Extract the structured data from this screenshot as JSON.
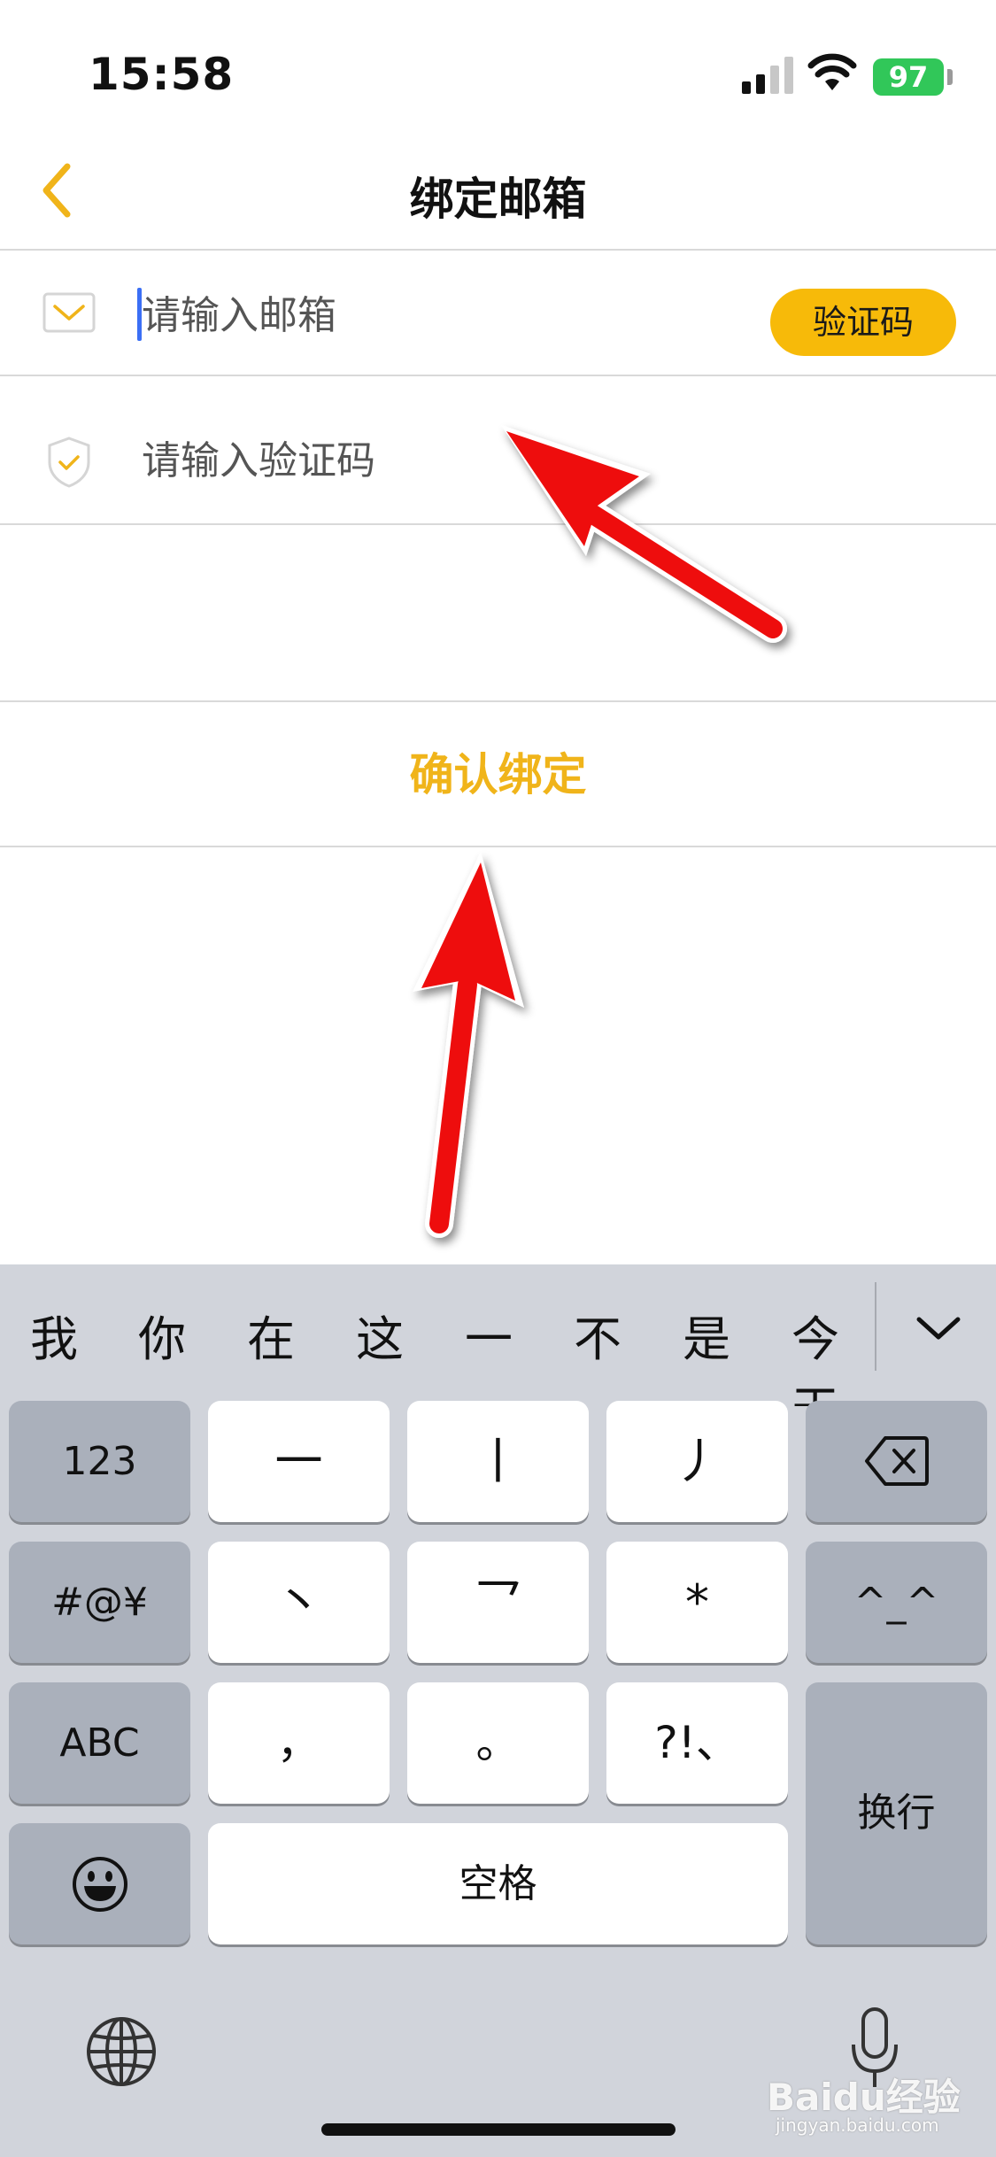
{
  "status_bar": {
    "time": "15:58",
    "battery": "97"
  },
  "nav": {
    "title": "绑定邮箱"
  },
  "form": {
    "email_placeholder": "请输入邮箱",
    "code_button": "验证码",
    "code_placeholder": "请输入验证码",
    "confirm_button": "确认绑定"
  },
  "keyboard": {
    "candidates": [
      "我",
      "你",
      "在",
      "这",
      "一",
      "不",
      "是",
      "今天"
    ],
    "keys": {
      "numbers": "123",
      "symbols": "#@¥",
      "abc": "ABC",
      "stroke_heng": "一",
      "stroke_shu": "丨",
      "stroke_pie": "丿",
      "stroke_dian": "丶",
      "stroke_zhe": "乛",
      "star": "*",
      "emoticon": "^_^",
      "comma": "，",
      "period": "。",
      "punct": "?!、",
      "return": "换行",
      "space": "空格"
    }
  },
  "watermark": {
    "brand": "Baidu经验",
    "url": "jingyan.baidu.com"
  },
  "colors": {
    "accent": "#f7ba09",
    "confirm_text": "#f0b41a",
    "arrow": "#ee1111",
    "keyboard_bg": "#d1d4db"
  }
}
